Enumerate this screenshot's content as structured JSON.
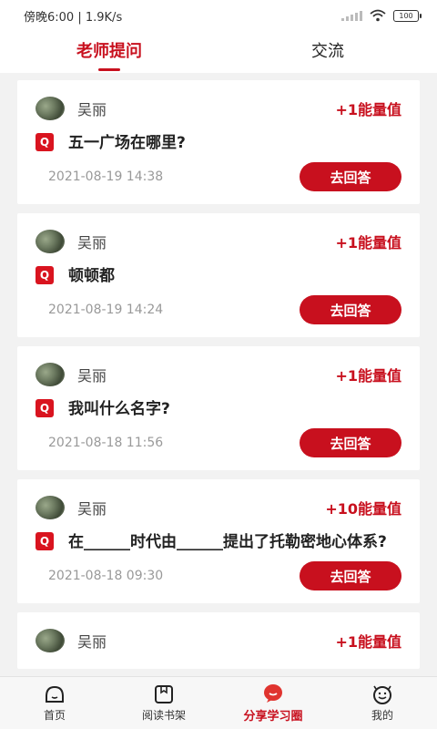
{
  "status": {
    "time": "傍晚6:00",
    "speed": "1.9K/s",
    "battery": "100"
  },
  "tabs": [
    {
      "label": "老师提问",
      "active": true
    },
    {
      "label": "交流",
      "active": false
    }
  ],
  "questions": [
    {
      "user": "吴丽",
      "energy": "+1能量值",
      "badge": "Q",
      "question": "五一广场在哪里?",
      "time": "2021-08-19 14:38",
      "action": "去回答"
    },
    {
      "user": "吴丽",
      "energy": "+1能量值",
      "badge": "Q",
      "question": "顿顿都",
      "time": "2021-08-19 14:24",
      "action": "去回答"
    },
    {
      "user": "吴丽",
      "energy": "+1能量值",
      "badge": "Q",
      "question": "我叫什么名字?",
      "time": "2021-08-18 11:56",
      "action": "去回答"
    },
    {
      "user": "吴丽",
      "energy": "+10能量值",
      "badge": "Q",
      "question": "在______时代由______提出了托勒密地心体系?",
      "time": "2021-08-18 09:30",
      "action": "去回答"
    },
    {
      "user": "吴丽",
      "energy": "+1能量值",
      "badge": "Q",
      "question": "",
      "time": "",
      "action": ""
    }
  ],
  "nav": [
    {
      "label": "首页",
      "icon": "home-icon"
    },
    {
      "label": "阅读书架",
      "icon": "bookshelf-icon"
    },
    {
      "label": "分享学习圈",
      "icon": "chat-bubble-icon",
      "active": true
    },
    {
      "label": "我的",
      "icon": "profile-face-icon"
    }
  ],
  "colors": {
    "accent": "#c8101e",
    "background": "#f2f2f2"
  }
}
